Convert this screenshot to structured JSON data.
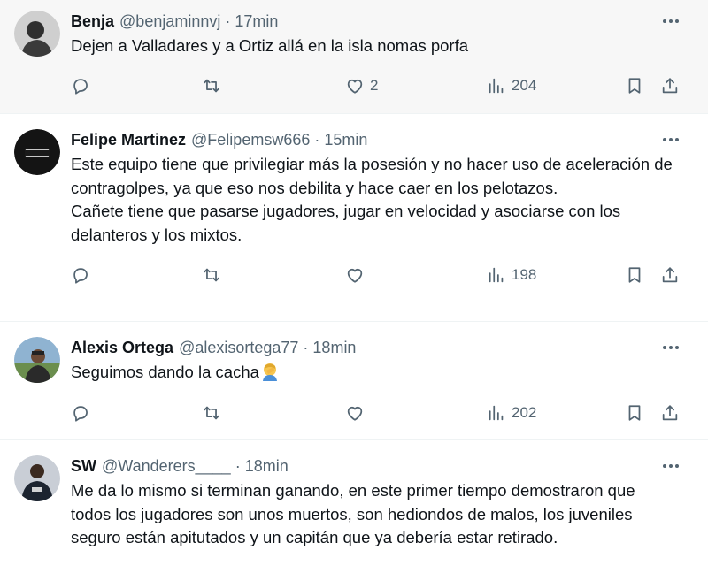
{
  "tweets": [
    {
      "name": "Benja",
      "handle": "@benjaminnvj",
      "separator": "·",
      "time": "17min",
      "text": "Dejen a Valladares y a Ortiz allá en la isla nomas porfa",
      "likes": "2",
      "views": "204",
      "avatar_colors": [
        "#d9d9d9",
        "#2f2f2f"
      ]
    },
    {
      "name": "Felipe Martinez",
      "handle": "@Felipemsw666",
      "separator": "·",
      "time": "15min",
      "text": "Este equipo tiene que privilegiar más la posesión y no hacer uso de aceleración de contragolpes, ya que eso nos debilita y hace caer en los pelotazos.\nCañete tiene que pasarse jugadores, jugar en velocidad y asociarse con los delanteros y los mixtos.",
      "likes": "",
      "views": "198",
      "avatar_colors": [
        "#1a1a1a",
        "#3a3a3a"
      ]
    },
    {
      "name": "Alexis Ortega",
      "handle": "@alexisortega77",
      "separator": "·",
      "time": "18min",
      "text": "Seguimos dando la cacha",
      "likes": "",
      "views": "202",
      "avatar_colors": [
        "#7fa7c9",
        "#3b2a20"
      ]
    },
    {
      "name": "SW",
      "handle": "@Wanderers____",
      "separator": "·",
      "time": "18min",
      "text": "Me da lo mismo si terminan ganando, en este primer tiempo demostraron que todos los jugadores son unos muertos, son hediondos de malos, los juveniles seguro están apitutados y un capitán que ya debería estar retirado.",
      "likes": "",
      "views": "",
      "avatar_colors": [
        "#1c2430",
        "#3c4a5a"
      ]
    }
  ],
  "icons": {
    "reply": "reply-icon",
    "retweet": "retweet-icon",
    "like": "heart-icon",
    "views": "views-icon",
    "bookmark": "bookmark-icon",
    "share": "share-icon",
    "more": "more-icon",
    "emoji": "facepalm-emoji-icon"
  }
}
